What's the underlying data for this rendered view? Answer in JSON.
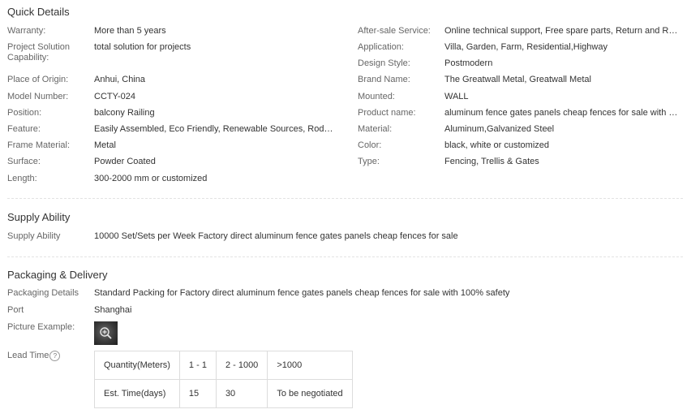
{
  "quick_details": {
    "title": "Quick Details",
    "left": [
      {
        "label": "Warranty:",
        "value": "More than 5 years"
      },
      {
        "label": "Project Solution Capability:",
        "value": "total solution for projects"
      },
      {
        "label": "Place of Origin:",
        "value": "Anhui, China"
      },
      {
        "label": "Model Number:",
        "value": "CCTY-024"
      },
      {
        "label": "Position:",
        "value": "balcony Railing"
      },
      {
        "label": "Feature:",
        "value": "Easily Assembled, Eco Friendly, Renewable Sources, Rodent…"
      },
      {
        "label": "Frame Material:",
        "value": "Metal"
      },
      {
        "label": "Surface:",
        "value": "Powder Coated"
      },
      {
        "label": "Length:",
        "value": "300-2000 mm or customized"
      }
    ],
    "right": [
      {
        "label": "After-sale Service:",
        "value": "Online technical support, Free spare parts, Return and Repla…"
      },
      {
        "label": "Application:",
        "value": "Villa, Garden, Farm, Residential,Highway"
      },
      {
        "label": "Design Style:",
        "value": "Postmodern"
      },
      {
        "label": "Brand Name:",
        "value": "The Greatwall Metal, Greatwall Metal"
      },
      {
        "label": "Mounted:",
        "value": "WALL"
      },
      {
        "label": "Product name:",
        "value": "aluminum fence gates panels cheap fences for sale with 10…"
      },
      {
        "label": "Material:",
        "value": "Aluminum,Galvanized Steel"
      },
      {
        "label": "Color:",
        "value": "black, white or customized"
      },
      {
        "label": "Type:",
        "value": "Fencing, Trellis & Gates"
      }
    ]
  },
  "supply_ability": {
    "title": "Supply Ability",
    "label": "Supply Ability",
    "value": "10000 Set/Sets per Week Factory direct aluminum fence gates panels cheap fences for sale"
  },
  "packaging_delivery": {
    "title": "Packaging & Delivery",
    "packaging_details_label": "Packaging Details",
    "packaging_details_value": "Standard Packing for Factory direct aluminum fence gates panels cheap fences for sale with 100% safety",
    "port_label": "Port",
    "port_value": "Shanghai",
    "picture_example_label": "Picture Example:",
    "picture_icon": "zoom-in-icon",
    "lead_time_label": "Lead Time",
    "help_icon": "?",
    "lead_time_table": {
      "row1": [
        "Quantity(Meters)",
        "1 - 1",
        "2 - 1000",
        ">1000"
      ],
      "row2": [
        "Est. Time(days)",
        "15",
        "30",
        "To be negotiated"
      ]
    }
  }
}
